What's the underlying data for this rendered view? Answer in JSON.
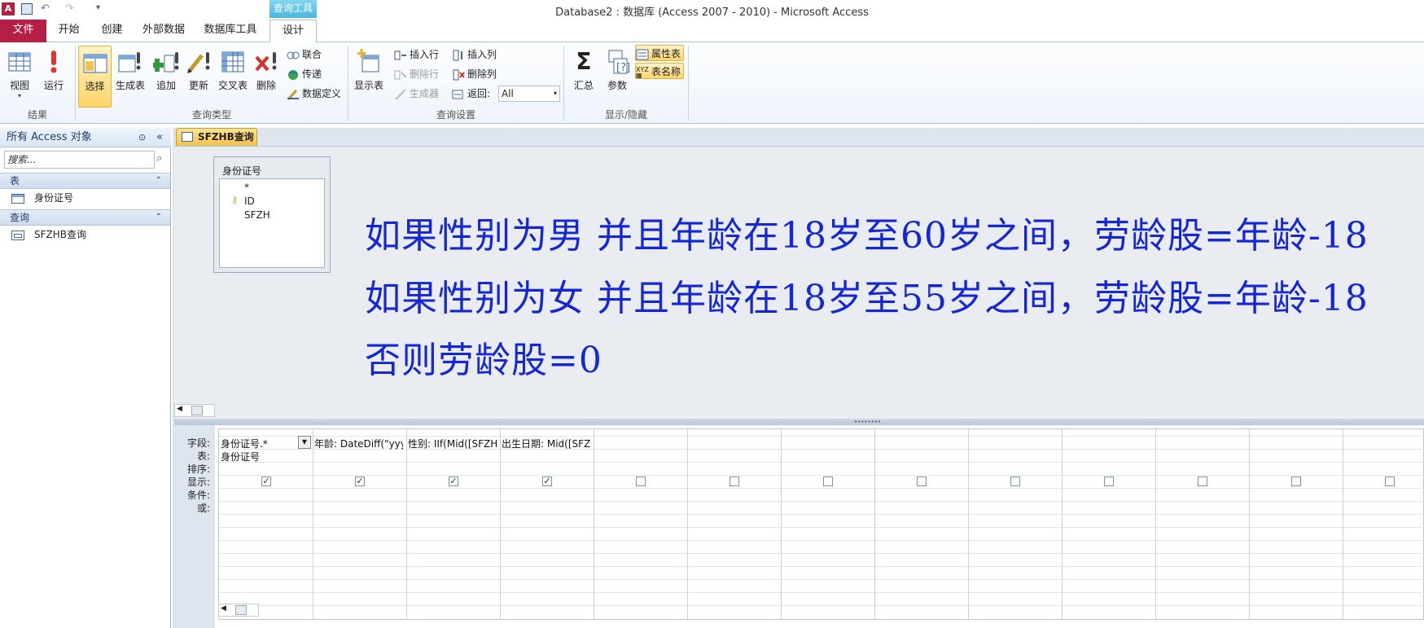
{
  "window": {
    "title": "Database2 : 数据库 (Access 2007 - 2010) - Microsoft Access"
  },
  "contextual_tab": {
    "label": "查询工具"
  },
  "tabs": [
    {
      "label": "文件"
    },
    {
      "label": "开始"
    },
    {
      "label": "创建"
    },
    {
      "label": "外部数据"
    },
    {
      "label": "数据库工具"
    },
    {
      "label": "设计"
    }
  ],
  "ribbon": {
    "results": {
      "label": "结果",
      "view": "视图",
      "run": "运行"
    },
    "query_type": {
      "label": "查询类型",
      "select": "选择",
      "make_table": "生成表",
      "append": "追加",
      "update": "更新",
      "crosstab": "交叉表",
      "delete": "删除",
      "union": "联合",
      "pass_through": "传递",
      "data_definition": "数据定义"
    },
    "query_setup": {
      "label": "查询设置",
      "show_table": "显示表",
      "insert_row": "插入行",
      "delete_row": "删除行",
      "builder": "生成器",
      "insert_col": "插入列",
      "delete_col": "删除列",
      "return_label": "返回:",
      "return_value": "All"
    },
    "show_hide": {
      "label": "显示/隐藏",
      "totals": "汇总",
      "parameters": "参数",
      "property_sheet": "属性表",
      "table_names": "表名称"
    }
  },
  "nav": {
    "header": "所有 Access 对象",
    "search_placeholder": "搜索...",
    "sections": [
      {
        "label": "表",
        "items": [
          "身份证号"
        ]
      },
      {
        "label": "查询",
        "items": [
          "SFZHB查询"
        ]
      }
    ]
  },
  "document": {
    "tab_label": "SFZHB查询",
    "table_box": {
      "title": "身份证号",
      "fields": [
        "*",
        "ID",
        "SFZH"
      ]
    },
    "annotation": [
      "如果性别为男  并且年龄在18岁至60岁之间，劳龄股=年龄-18",
      "如果性别为女  并且年龄在18岁至55岁之间，劳龄股=年龄-18",
      "否则劳龄股=0"
    ]
  },
  "grid": {
    "row_labels": [
      "字段:",
      "表:",
      "排序:",
      "显示:",
      "条件:",
      "或:"
    ],
    "columns": [
      {
        "field": "身份证号.*",
        "table": "身份证号",
        "show": true
      },
      {
        "field": "年龄: DateDiff(\"yyy",
        "table": "",
        "show": true
      },
      {
        "field": "性别: IIf(Mid([SFZH",
        "table": "",
        "show": true
      },
      {
        "field": "出生日期: Mid([SFZH",
        "table": "",
        "show": true
      },
      {
        "field": "",
        "table": "",
        "show": false
      },
      {
        "field": "",
        "table": "",
        "show": false
      },
      {
        "field": "",
        "table": "",
        "show": false
      },
      {
        "field": "",
        "table": "",
        "show": false
      },
      {
        "field": "",
        "table": "",
        "show": false
      },
      {
        "field": "",
        "table": "",
        "show": false
      },
      {
        "field": "",
        "table": "",
        "show": false
      },
      {
        "field": "",
        "table": "",
        "show": false
      },
      {
        "field": "",
        "table": "",
        "show": false
      },
      {
        "field": "",
        "table": "",
        "show": false
      }
    ]
  },
  "colors": {
    "accent_file": "#b51f45",
    "annotation": "#1426d6",
    "highlight": "#ffd56a"
  }
}
